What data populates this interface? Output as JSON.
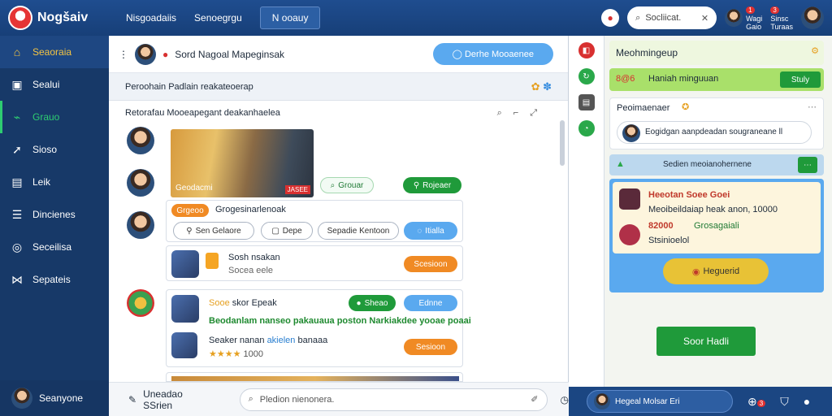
{
  "app": {
    "name": "Nogšaiv"
  },
  "topnav": {
    "items": [
      "Nisgoadaiis",
      "Senoegrgu",
      "N ooauy"
    ]
  },
  "search": {
    "placeholder": "Socliicat."
  },
  "topbar_users": [
    {
      "line1": "Wagi",
      "line2": "Gaio",
      "badge": "1"
    },
    {
      "line1": "Sinsc",
      "line2": "Turaas",
      "badge": "3"
    }
  ],
  "sidebar": {
    "items": [
      {
        "label": "Seaoraia",
        "icon": "home-icon"
      },
      {
        "label": "Sealui",
        "icon": "monitor-icon"
      },
      {
        "label": "Grauo",
        "icon": "pulse-icon"
      },
      {
        "label": "Sioso",
        "icon": "arrow-icon"
      },
      {
        "label": "Leik",
        "icon": "box-icon"
      },
      {
        "label": "Dincienes",
        "icon": "list-icon"
      },
      {
        "label": "Seceilisa",
        "icon": "compass-icon"
      },
      {
        "label": "Sepateis",
        "icon": "share-icon"
      }
    ],
    "user": "Seanyone"
  },
  "chat": {
    "header_title": "Sord Nagoal Mapeginsak",
    "header_button": "Derhe Mooaenee",
    "subheader": "Peroohain Padlain reakateoerap",
    "feed_title": "Retorafau Mooeapegant deakanhaelea"
  },
  "post1": {
    "photo_tag": "JASEE",
    "photo_caption": "Geodacmi",
    "btn_a": "Grouar",
    "btn_b": "Rojeaer",
    "chip": "Grgeoo",
    "chip_text": "Grogesinarlenoak",
    "options": [
      "Sen Gelaore",
      "Depe",
      "Sepadie Kentoon",
      "Itialla"
    ]
  },
  "post2": {
    "title": "Sosh nsakan",
    "sub": "Socea eele",
    "btn": "Scesioon"
  },
  "post3": {
    "title_a": "Sooe",
    "title_b": "skor Epeak",
    "btn_a": "Sheao",
    "btn_b": "Ednne",
    "highlight": "Beodanlam nanseo pakauaua poston Narkiakdee yooae poaai",
    "line": "Seaker nanan",
    "line_hl": "akielen",
    "line_rest": "banaaa",
    "rating": "1000",
    "btn": "Sesioon"
  },
  "composer": {
    "left_label": "Uneadao SSrien",
    "placeholder": "Pledion nienonera."
  },
  "right_panel": {
    "title": "Meohmingeup",
    "green_row": "Haniah minguuan",
    "green_row_prefix": "8@6",
    "green_btn": "Stuly",
    "card_title": "Peoimaenaer",
    "card_user_text": "Eogidgan aanpdeadan sougraneane ll",
    "blue_row": "Sedien meoianohernene",
    "promo_a_title": "Heeotan Soee Goei",
    "promo_a_line": "Meoibeildaiap heak anon, 10000",
    "promo_b_price": "82000",
    "promo_b_tag": "Grosagaiali",
    "promo_b_line": "Stsinioelol",
    "promo_btn": "Heguerid",
    "cta": "Soor Hadli"
  },
  "bottom_right": {
    "pill": "Hegeal Molsar Eri",
    "badge": "3"
  }
}
